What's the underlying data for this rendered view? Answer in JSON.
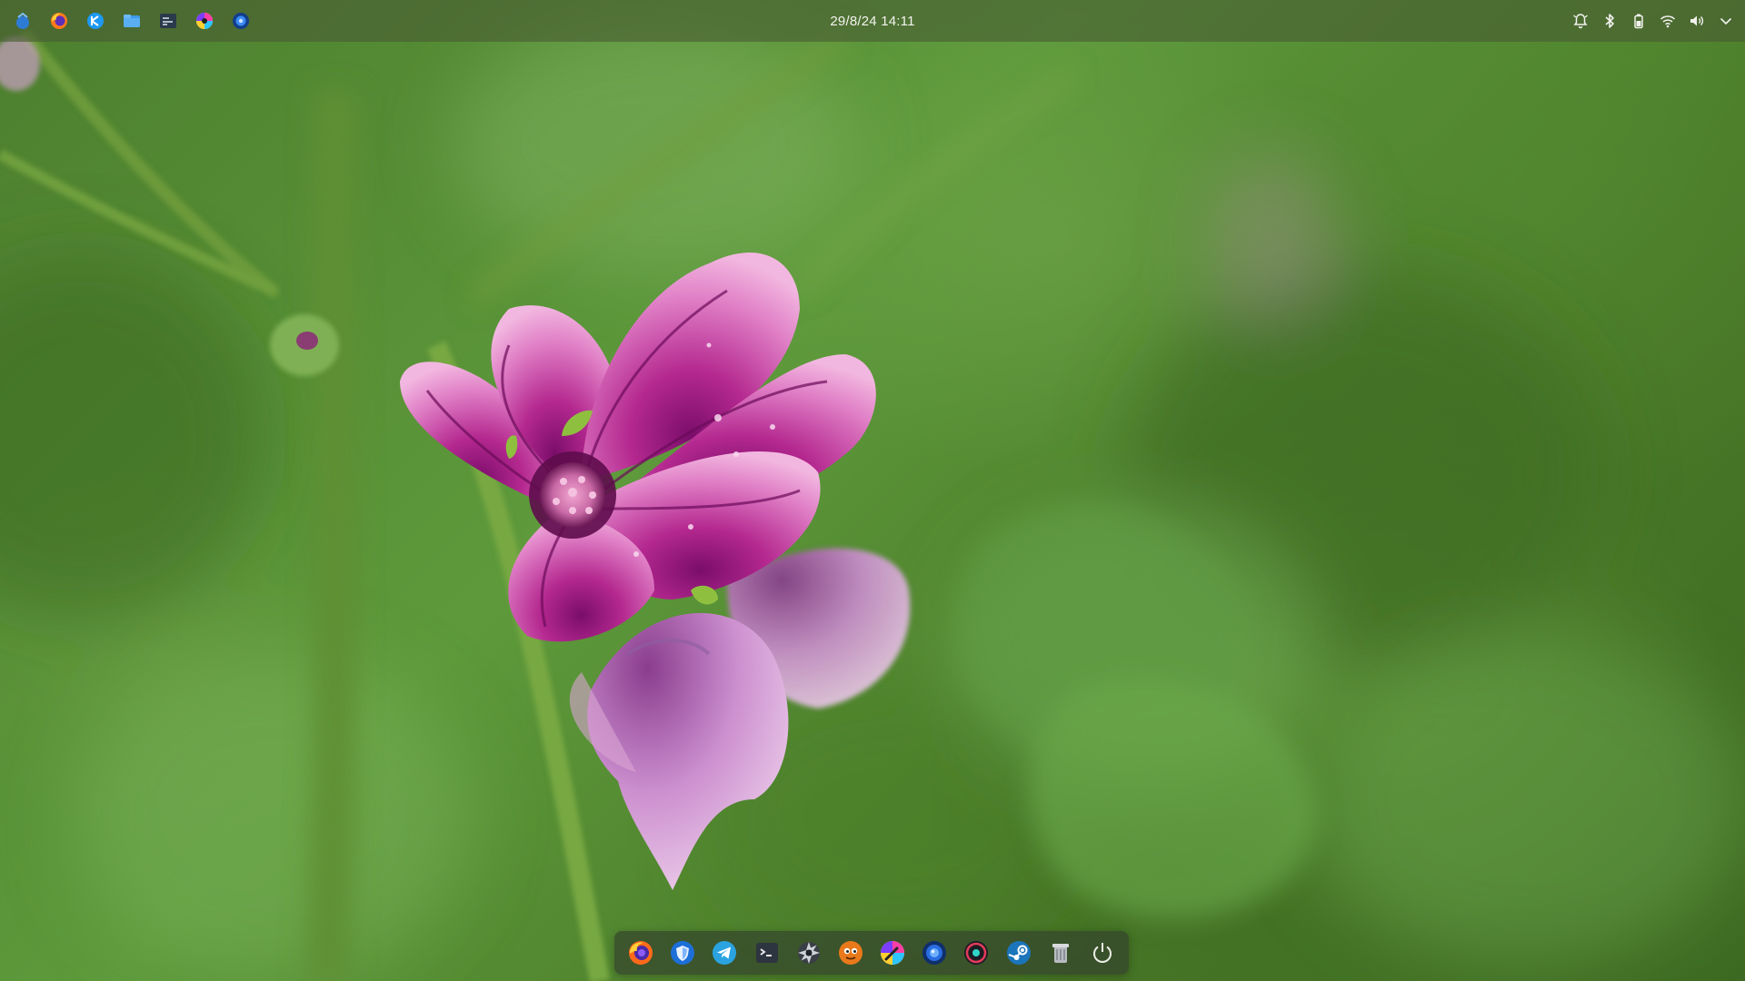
{
  "panel": {
    "clock": "29/8/24 14:11",
    "launchers": [
      {
        "name": "app-launcher-icon"
      },
      {
        "name": "firefox-icon"
      },
      {
        "name": "kde-connect-icon"
      },
      {
        "name": "file-manager-icon"
      },
      {
        "name": "system-monitor-icon"
      },
      {
        "name": "color-picker-icon"
      },
      {
        "name": "browser-icon"
      }
    ],
    "tray": [
      {
        "name": "notifications-icon"
      },
      {
        "name": "bluetooth-icon"
      },
      {
        "name": "battery-icon"
      },
      {
        "name": "wifi-icon"
      },
      {
        "name": "volume-icon"
      },
      {
        "name": "tray-expand-icon"
      }
    ]
  },
  "dock": {
    "items": [
      {
        "name": "firefox-icon"
      },
      {
        "name": "shield-browser-icon"
      },
      {
        "name": "telegram-icon"
      },
      {
        "name": "terminal-icon"
      },
      {
        "name": "aperture-icon"
      },
      {
        "name": "game-icon"
      },
      {
        "name": "color-picker-icon"
      },
      {
        "name": "browser-icon"
      },
      {
        "name": "media-player-icon"
      },
      {
        "name": "steam-icon"
      },
      {
        "name": "trash-icon"
      },
      {
        "name": "power-icon"
      }
    ]
  },
  "colors": {
    "panel_bg": "#485c34",
    "dock_bg": "#34442c",
    "text": "#f3f3ee",
    "flower": "#c53a98",
    "leaves": "#5e9a3c"
  }
}
